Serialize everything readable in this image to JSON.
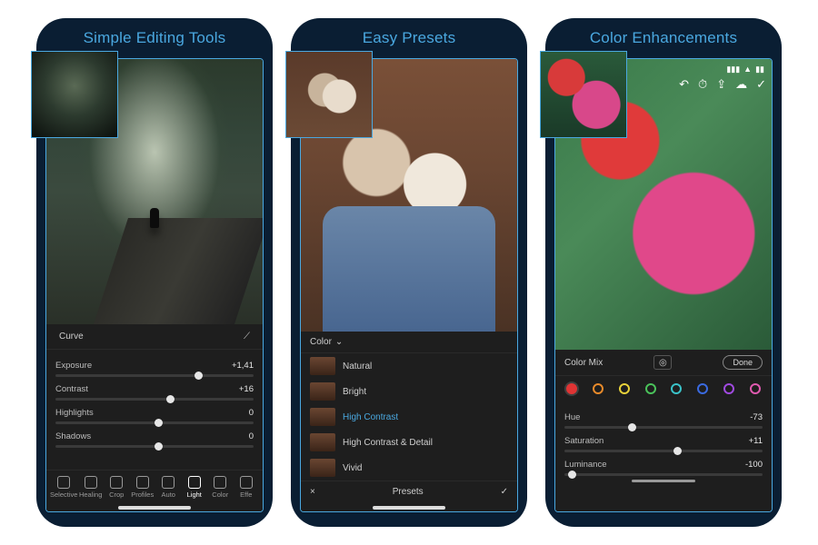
{
  "phones": [
    {
      "title": "Simple Editing Tools",
      "tabs": {
        "curve": "Curve"
      },
      "sliders": [
        {
          "label": "Exposure",
          "value": "+1,41",
          "pos": 0.7
        },
        {
          "label": "Contrast",
          "value": "+16",
          "pos": 0.56
        },
        {
          "label": "Highlights",
          "value": "0",
          "pos": 0.5
        },
        {
          "label": "Shadows",
          "value": "0",
          "pos": 0.5
        }
      ],
      "bottombar": [
        {
          "label": "Selective",
          "active": false
        },
        {
          "label": "Healing",
          "active": false
        },
        {
          "label": "Crop",
          "active": false
        },
        {
          "label": "Profiles",
          "active": false
        },
        {
          "label": "Auto",
          "active": false
        },
        {
          "label": "Light",
          "active": true
        },
        {
          "label": "Color",
          "active": false
        },
        {
          "label": "Effe",
          "active": false
        }
      ]
    },
    {
      "title": "Easy Presets",
      "color_label": "Color",
      "presets": [
        {
          "label": "Natural",
          "selected": false
        },
        {
          "label": "Bright",
          "selected": false
        },
        {
          "label": "High Contrast",
          "selected": true
        },
        {
          "label": "High Contrast & Detail",
          "selected": false
        },
        {
          "label": "Vivid",
          "selected": false
        }
      ],
      "presets_bar": {
        "close": "×",
        "title": "Presets",
        "confirm": "✓"
      }
    },
    {
      "title": "Color Enhancements",
      "mix_label": "Color Mix",
      "done_label": "Done",
      "swatches": [
        {
          "hex": "#e03434",
          "selected": true
        },
        {
          "hex": "#e88a2a",
          "selected": false
        },
        {
          "hex": "#e8d23a",
          "selected": false
        },
        {
          "hex": "#4ac25a",
          "selected": false
        },
        {
          "hex": "#3ac2c8",
          "selected": false
        },
        {
          "hex": "#3a6ae0",
          "selected": false
        },
        {
          "hex": "#a04ae0",
          "selected": false
        },
        {
          "hex": "#e05ab0",
          "selected": false
        }
      ],
      "sliders": [
        {
          "label": "Hue",
          "value": "-73",
          "pos": 0.32
        },
        {
          "label": "Saturation",
          "value": "+11",
          "pos": 0.55
        },
        {
          "label": "Luminance",
          "value": "-100",
          "pos": 0.02
        }
      ]
    }
  ]
}
